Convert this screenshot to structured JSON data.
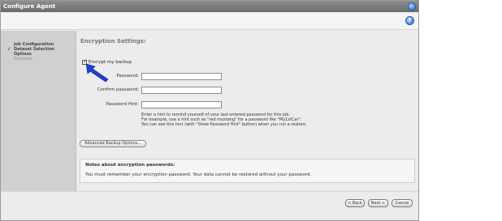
{
  "window": {
    "title": "Configure Agent"
  },
  "toolbar": {
    "help_glyph": "?"
  },
  "sidebar": {
    "steps": [
      {
        "label": "Job Configuration",
        "completed": false
      },
      {
        "label": "Dataset Selection",
        "completed": true,
        "check": "√"
      },
      {
        "label": "Options",
        "completed": false
      },
      {
        "label": "Schedule",
        "completed": false
      }
    ]
  },
  "main": {
    "section_title": "Encryption Settings:",
    "encrypt_checkbox": {
      "label": "Encrypt my backup",
      "checked": true,
      "glyph": "✓"
    },
    "fields": {
      "password_label": "Password:",
      "confirm_label": "Confirm password:",
      "hint_label": "Password Hint:",
      "password_value": "",
      "confirm_value": "",
      "hint_value": ""
    },
    "hint_help": [
      "Enter a hint to remind yourself of your last entered password for this job.",
      "For example, use a hint such as \"red mustang\" for a password like \"My1stCar\".",
      "You can see this hint (with \"Show Password Hint\" button) when you run a restore."
    ],
    "advanced_button": "Advanced Backup Options...",
    "notes": {
      "title": "Notes about encryption passwords:",
      "body": "You must remember your encryption password. Your data cannot be restored without your password."
    }
  },
  "footer": {
    "back_label": "< Back",
    "next_label": "Next >",
    "cancel_label": "Cancel"
  },
  "colors": {
    "accent": "#2a74c9",
    "arrow": "#1f3fd1",
    "titlebar": "#7a7a7a"
  },
  "icons": {
    "title_close": "close-icon",
    "help": "help-icon",
    "annotation": "arrow-pointer-icon"
  }
}
